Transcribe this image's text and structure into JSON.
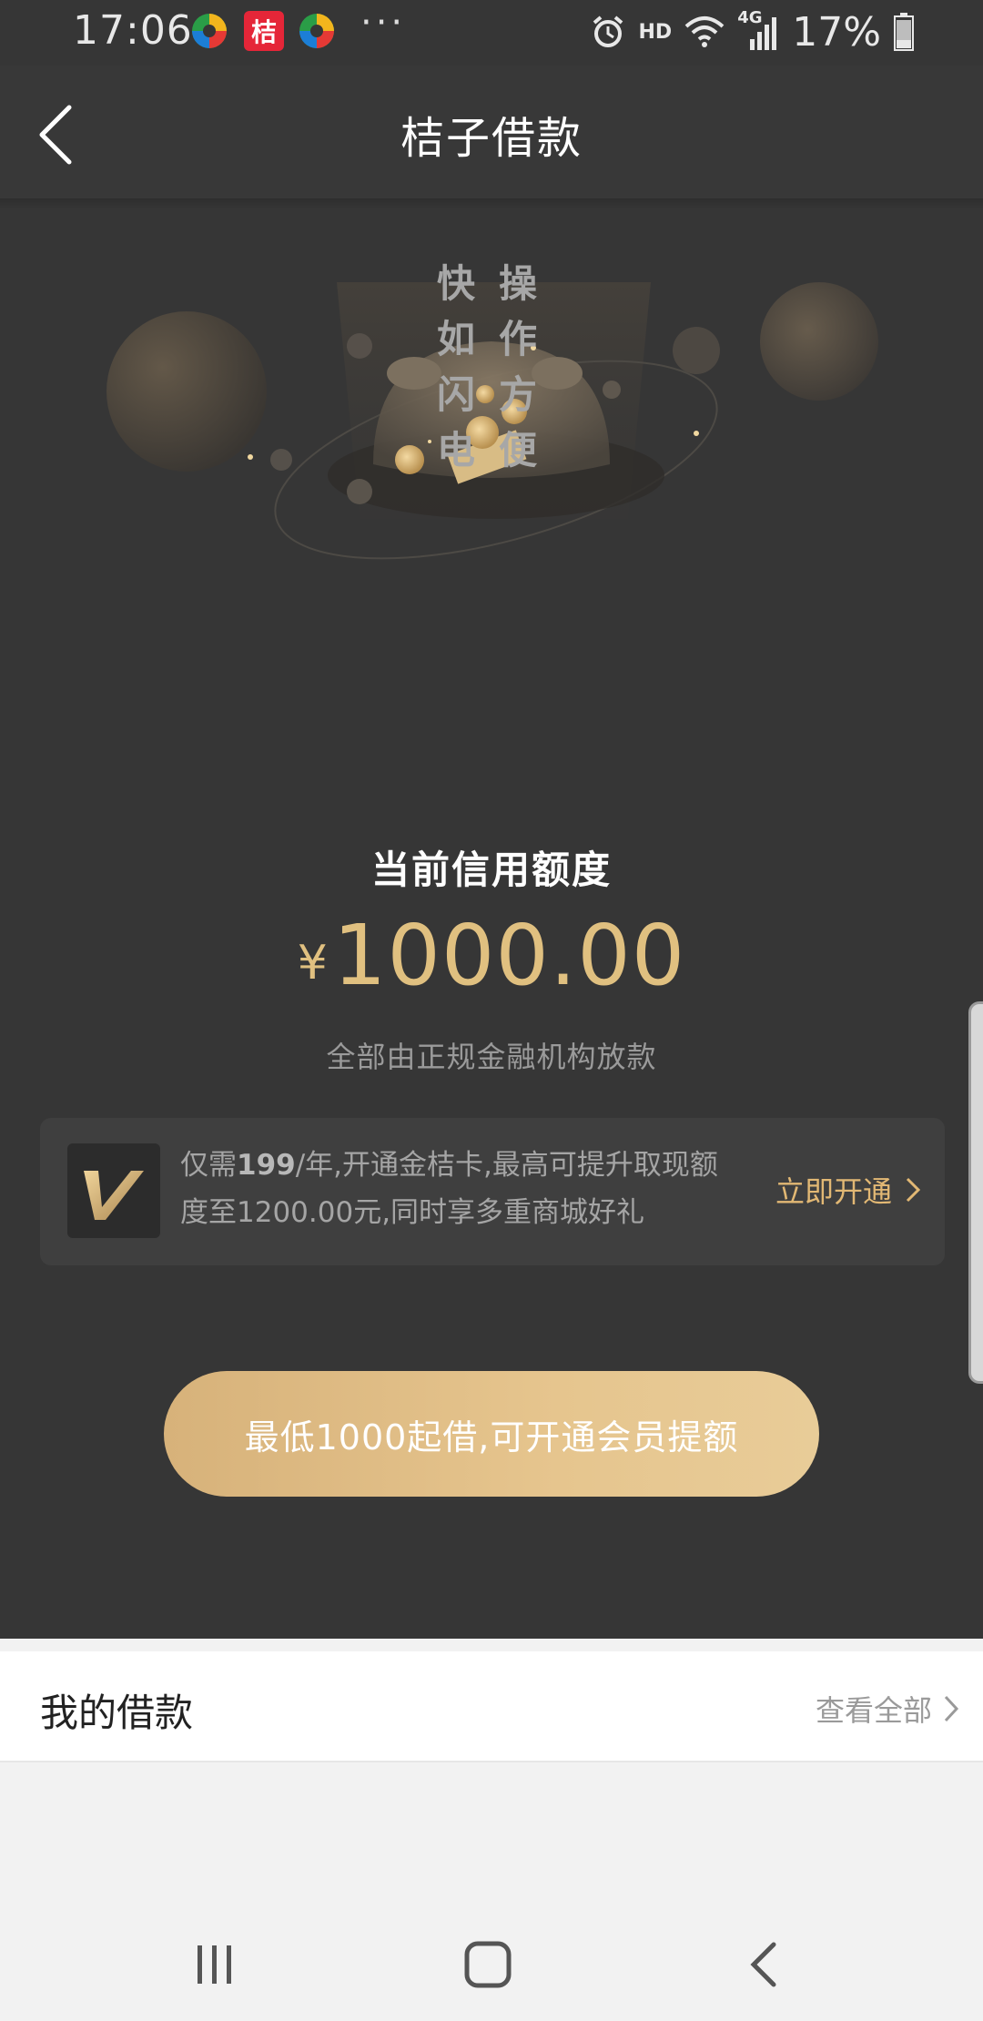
{
  "status_bar": {
    "time": "17:06",
    "notif_badge_text": "桔",
    "dots": "···",
    "network_label": "HD",
    "signal_label": "4G",
    "battery": "17%"
  },
  "header": {
    "title": "桔子借款"
  },
  "hero": {
    "slogan_left": [
      "快",
      "如",
      "闪",
      "电"
    ],
    "slogan_right": [
      "操",
      "作",
      "方",
      "便"
    ],
    "coin_symbol": "₿"
  },
  "credit": {
    "title": "当前信用额度",
    "currency": "¥",
    "amount": "1000.00",
    "note": "全部由正规金融机构放款"
  },
  "member_card": {
    "text_pre": "仅需",
    "price": "199",
    "text_post": "/年,开通金桔卡,最高可提升取现额度至1200.00元,同时享多重商城好礼",
    "cta": "立即开通"
  },
  "borrow_button": {
    "label": "最低1000起借,可开通会员提额"
  },
  "loans": {
    "title": "我的借款",
    "view_all": "查看全部"
  },
  "colors": {
    "gold": "#e0c080",
    "cta_gold": "#e2b874",
    "dark_bg": "#363636",
    "notif_red": "#e52638"
  }
}
